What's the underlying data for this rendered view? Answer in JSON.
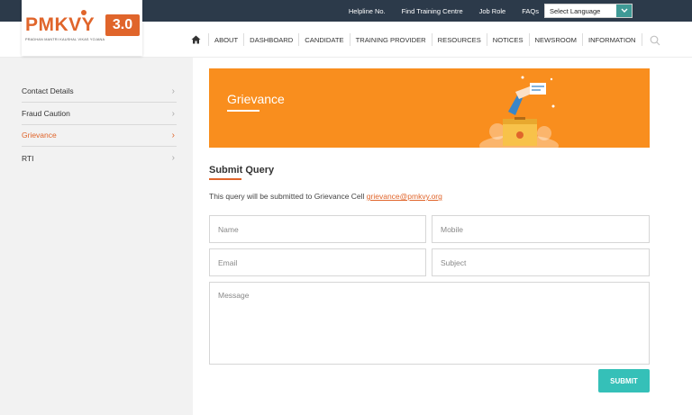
{
  "topbar": {
    "links": [
      "Helpline No.",
      "Find Training Centre",
      "Job Role",
      "FAQs"
    ],
    "language_select": {
      "value": "Select Language"
    }
  },
  "logo": {
    "name": "PMKVY",
    "version": "3.0",
    "tagline": "PRADHAN MANTRI KAUSHAL VIKAS YOJANA"
  },
  "nav": {
    "items": [
      "ABOUT",
      "DASHBOARD",
      "CANDIDATE",
      "TRAINING PROVIDER",
      "RESOURCES",
      "NOTICES",
      "NEWSROOM",
      "INFORMATION"
    ]
  },
  "sidebar": {
    "items": [
      {
        "label": "Contact Details",
        "active": false
      },
      {
        "label": "Fraud Caution",
        "active": false
      },
      {
        "label": "Grievance",
        "active": true
      },
      {
        "label": "RTI",
        "active": false
      }
    ]
  },
  "banner": {
    "title": "Grievance"
  },
  "form": {
    "title": "Submit Query",
    "info_text": "This query will be submitted to Grievance Cell ",
    "info_email": "grievance@pmkvy.org",
    "name_placeholder": "Name",
    "mobile_placeholder": "Mobile",
    "email_placeholder": "Email",
    "subject_placeholder": "Subject",
    "message_placeholder": "Message",
    "submit_label": "SUBMIT"
  },
  "colors": {
    "accent": "#e0652b",
    "banner": "#f98e1e",
    "topbar": "#2c3a4a",
    "submit": "#35c0b8"
  },
  "icons": [
    "home-icon",
    "search-icon",
    "chevron-right-icon",
    "chevron-down-icon"
  ]
}
